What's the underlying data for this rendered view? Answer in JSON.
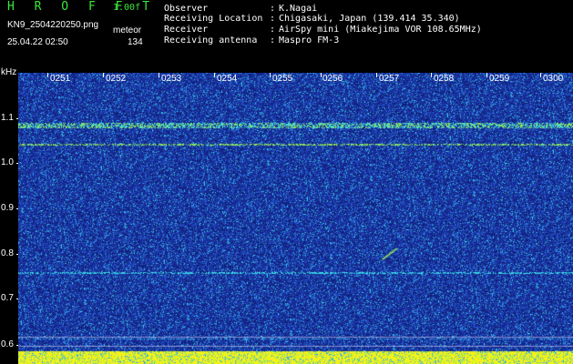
{
  "header": {
    "brand": "H R O F F T",
    "version": "1.00f",
    "filename": "KN9_2504220250.png",
    "datetime": "25.04.22 02:50",
    "meteor_label": "meteor",
    "meteor_count": "134"
  },
  "info": [
    {
      "label": "Observer",
      "value": "K.Nagai"
    },
    {
      "label": "Receiving Location",
      "value": "Chigasaki, Japan (139.414 35.340)"
    },
    {
      "label": "Receiver",
      "value": "AirSpy mini (Miakejima VOR 108.65MHz)"
    },
    {
      "label": "Receiving antenna",
      "value": "Maspro FM-3"
    }
  ],
  "axis": {
    "unit": "kHz",
    "y_ticks": [
      "1.1",
      "1.0",
      "0.9",
      "0.8",
      "0.7",
      "0.6"
    ],
    "x_ticks": [
      "0251",
      "0252",
      "0253",
      "0254",
      "0255",
      "0256",
      "0257",
      "0258",
      "0259",
      "0300"
    ]
  },
  "colors": {
    "background": "#000000",
    "waterfall_base": "#1a2f9c",
    "signal_cyan": "#38d8e8",
    "signal_green": "#8fe85a",
    "signal_yellow": "#f2f21a",
    "header_green": "#39e83a"
  }
}
